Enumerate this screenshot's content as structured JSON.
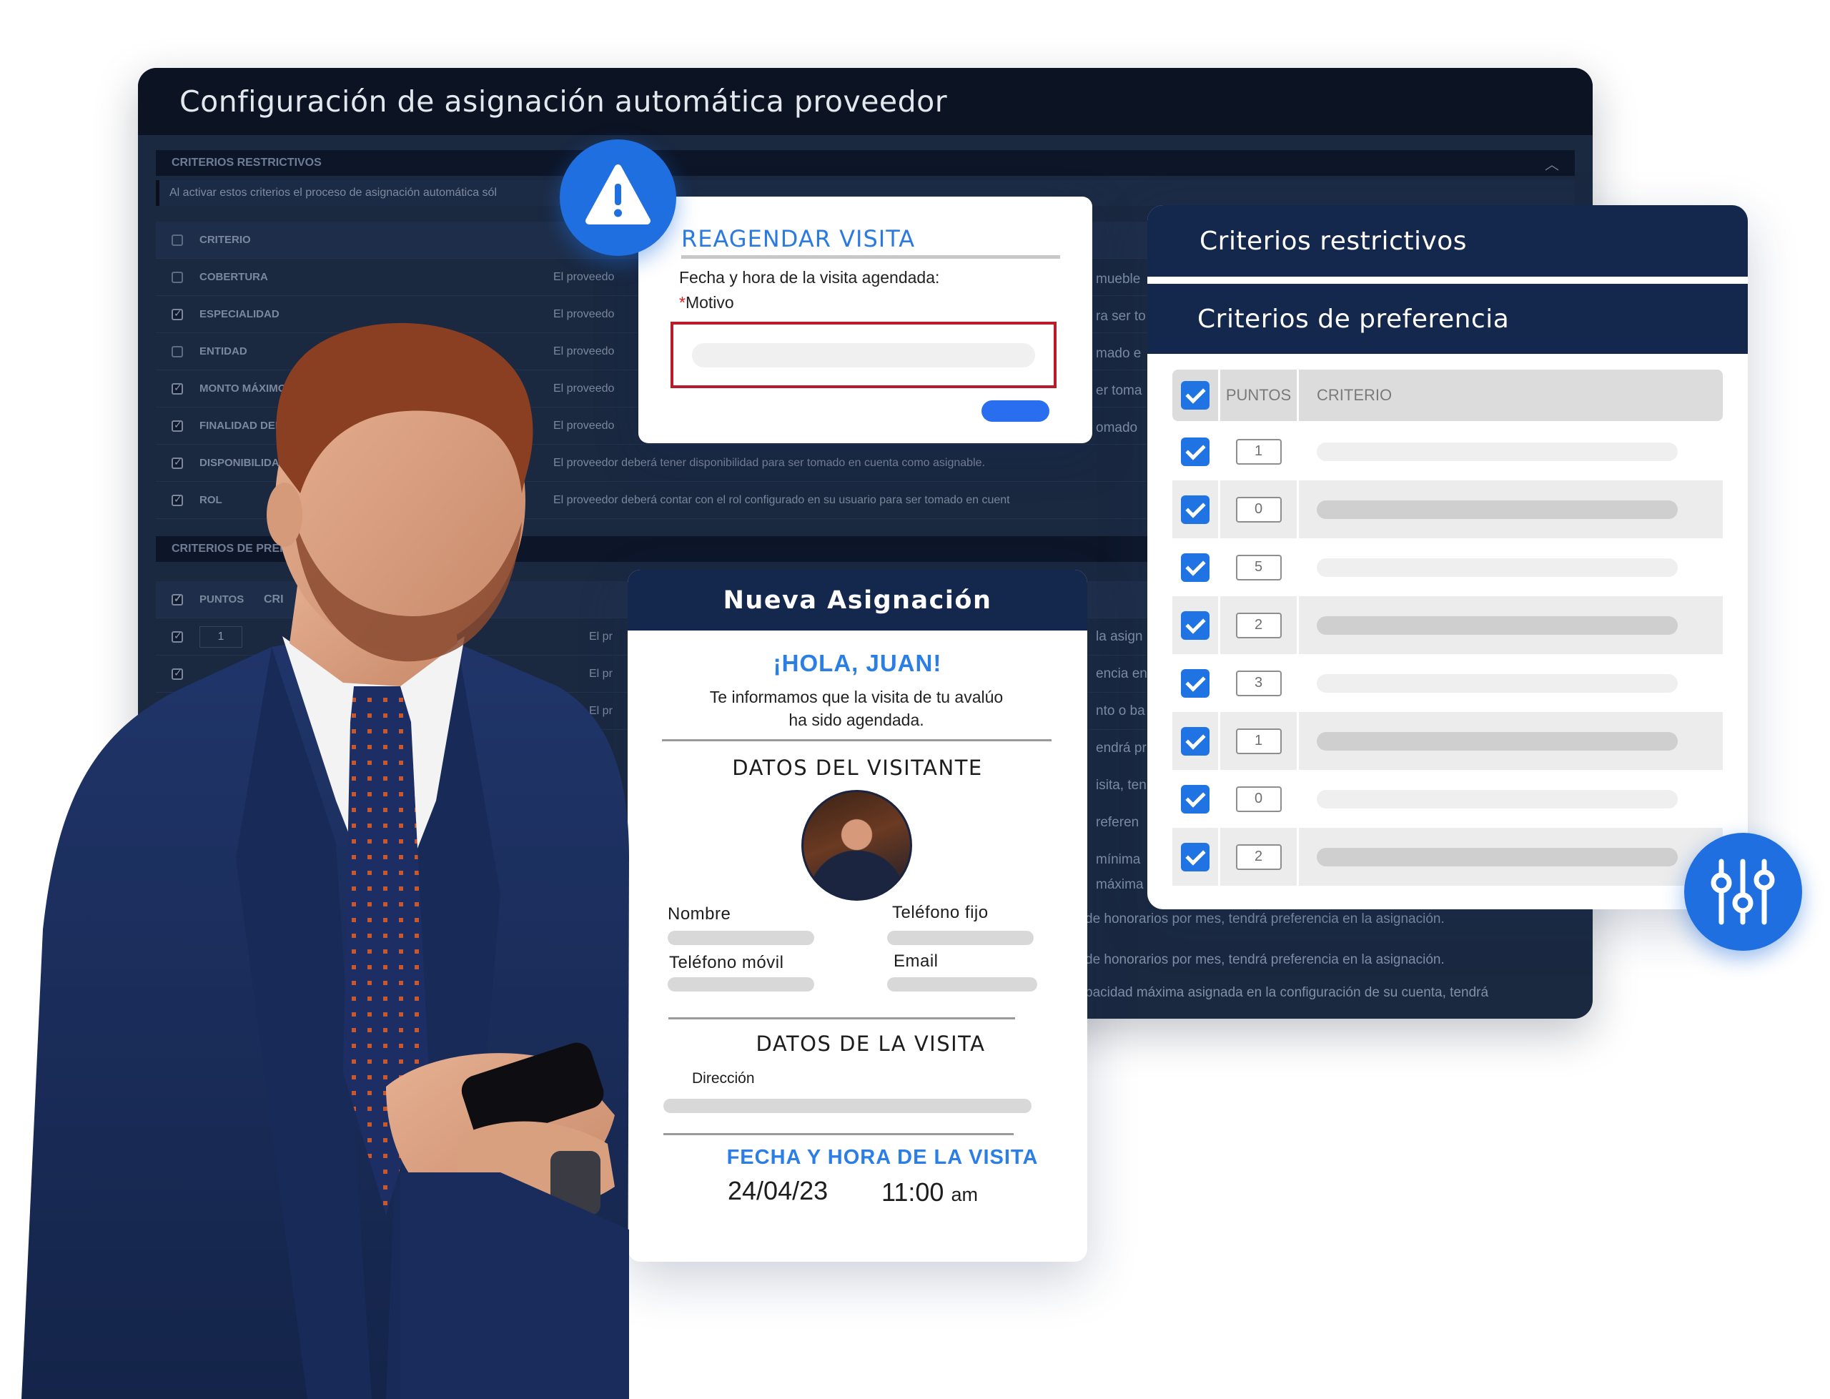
{
  "background_window": {
    "title": "Configuración de asignación automática proveedor",
    "restrictive_section_label": "CRITERIOS RESTRICTIVOS",
    "note": "Al activar estos criterios el proceso de asignación automática sól",
    "restrictive_table": {
      "header": "CRITERIO",
      "rows": [
        {
          "name": "COBERTURA",
          "desc": "El proveedo",
          "checked": false
        },
        {
          "name": "ESPECIALIDAD",
          "desc": "El proveedo",
          "checked": true
        },
        {
          "name": "ENTIDAD",
          "desc": "El proveedo",
          "checked": false
        },
        {
          "name": "MONTO MÁXIMO DE",
          "desc": "El proveedo",
          "checked": true
        },
        {
          "name": "FINALIDAD DEL A",
          "desc": "El proveedo",
          "checked": true
        },
        {
          "name": "DISPONIBILIDA",
          "desc": "El proveedor deberá tener disponibilidad para ser tomado en cuenta como asignable.",
          "checked": true
        },
        {
          "name": "ROL",
          "desc": "El proveedor deberá contar con el rol configurado en su usuario para ser tomado en cuent",
          "checked": true
        }
      ]
    },
    "preference_section_label": "CRITERIOS DE PREFE",
    "preference_table": {
      "points_header": "PUNTOS",
      "criteria_header": "CRI",
      "rows": [
        {
          "points": "1",
          "desc": "El pr"
        },
        {
          "points": "",
          "desc": "El pr"
        },
        {
          "points": "",
          "desc": "El pr"
        }
      ]
    },
    "side_fragments": [
      "mueble",
      "ra ser to",
      "mado e",
      "er toma",
      "omado",
      "la asign",
      "encia en",
      "nto o ba",
      "endrá pr",
      "isita, ten",
      "referen",
      " mínima",
      " máxima"
    ],
    "bottom_lines": [
      "de honorarios por mes, tendrá preferencia en la asignación.",
      "de honorarios por mes, tendrá preferencia en la asignación.",
      "pacidad máxima asignada en la configuración de su cuenta, tendrá"
    ]
  },
  "preference_card": {
    "restrictive_title": "Criterios restrictivos",
    "preference_title": "Criterios de preferencia",
    "points_header": "PUNTOS",
    "criteria_header": "CRITERIO",
    "rows": [
      {
        "points": "1",
        "shaded": false
      },
      {
        "points": "0",
        "shaded": true
      },
      {
        "points": "5",
        "shaded": false
      },
      {
        "points": "2",
        "shaded": true
      },
      {
        "points": "3",
        "shaded": false
      },
      {
        "points": "1",
        "shaded": true
      },
      {
        "points": "0",
        "shaded": false
      },
      {
        "points": "2",
        "shaded": true
      }
    ]
  },
  "reschedule_dialog": {
    "title": "REAGENDAR VISITA",
    "date_label": "Fecha y hora de la visita agendada:",
    "required_mark": "*",
    "reason_label": "Motivo",
    "reason_value": "",
    "reason_placeholder": ""
  },
  "assignment_card": {
    "header": "Nueva Asignación",
    "greeting": "¡HOLA, JUAN!",
    "message_line1": "Te informamos que la visita de tu avalúo",
    "message_line2": "ha sido agendada.",
    "visitor_section": "DATOS DEL VISITANTE",
    "fields": {
      "name": "Nombre",
      "landline": "Teléfono fijo",
      "mobile": "Teléfono móvil",
      "email": "Email"
    },
    "visit_section": "DATOS DE LA VISITA",
    "address_label": "Dirección",
    "datetime_section": "FECHA Y HORA DE LA VISITA",
    "date": "24/04/23",
    "time": "11:00",
    "ampm": "am"
  },
  "colors": {
    "navy": "#14284d",
    "accent_blue": "#1f73e3",
    "required_red": "#b81c2b"
  }
}
